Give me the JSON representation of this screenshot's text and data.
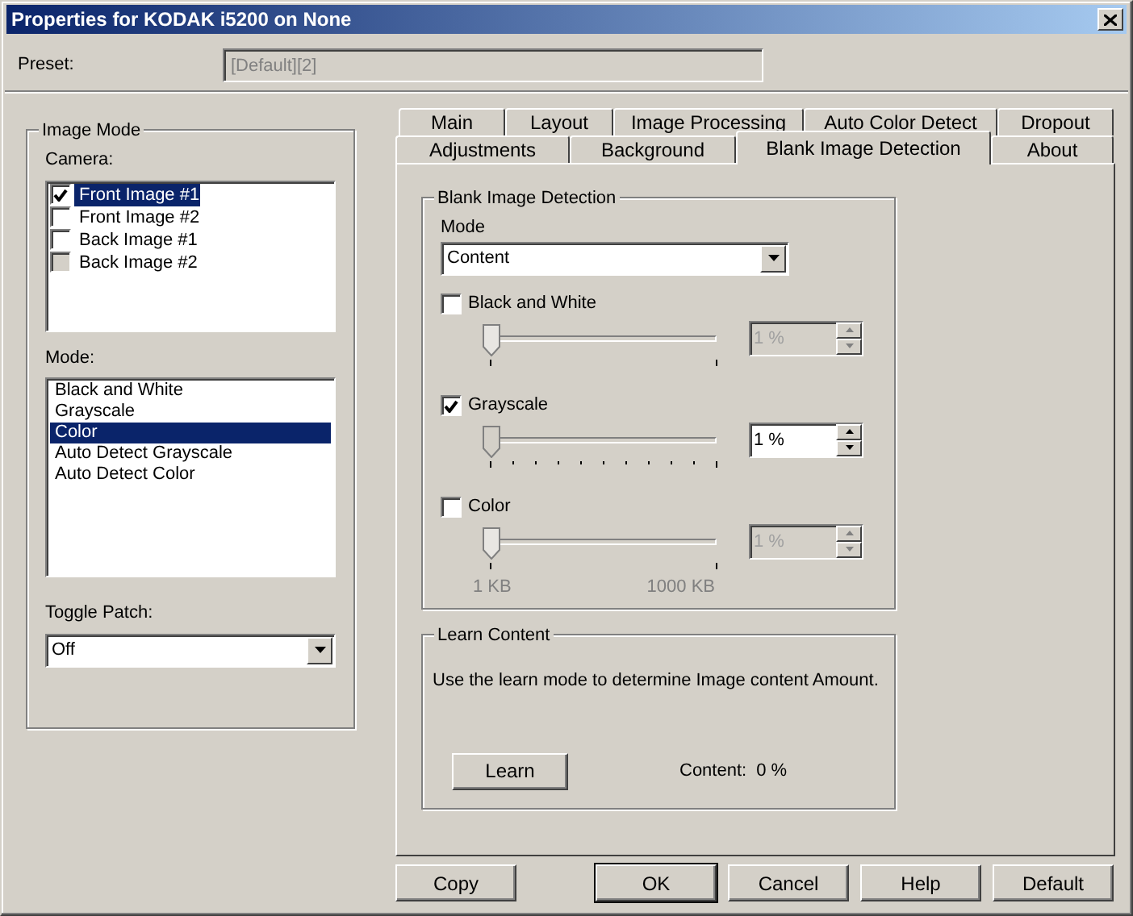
{
  "window": {
    "title": "Properties for KODAK i5200 on None"
  },
  "preset": {
    "label": "Preset:",
    "value": "[Default][2]",
    "disabled": true
  },
  "image_mode": {
    "title": "Image Mode",
    "camera_label": "Camera:",
    "cameras": [
      {
        "label": "Front Image #1",
        "checked": true,
        "disabled": false,
        "selected": true
      },
      {
        "label": "Front Image #2",
        "checked": false,
        "disabled": false,
        "selected": false
      },
      {
        "label": "Back Image #1",
        "checked": false,
        "disabled": false,
        "selected": false
      },
      {
        "label": "Back Image #2",
        "checked": false,
        "disabled": true,
        "selected": false
      }
    ],
    "mode_label": "Mode:",
    "modes": [
      {
        "label": "Black and White",
        "selected": false
      },
      {
        "label": "Grayscale",
        "selected": false
      },
      {
        "label": "Color",
        "selected": true
      },
      {
        "label": "Auto Detect Grayscale",
        "selected": false
      },
      {
        "label": "Auto Detect Color",
        "selected": false
      }
    ],
    "toggle_patch": {
      "label": "Toggle Patch:",
      "value": "Off"
    }
  },
  "tab_rows": [
    {
      "tabs": [
        {
          "label": "Main",
          "selected": false
        },
        {
          "label": "Layout",
          "selected": false
        },
        {
          "label": "Image Processing",
          "selected": false
        },
        {
          "label": "Auto Color Detect",
          "selected": false
        },
        {
          "label": "Dropout",
          "selected": false
        }
      ]
    },
    {
      "tabs": [
        {
          "label": "Adjustments",
          "selected": false
        },
        {
          "label": "Background",
          "selected": false
        },
        {
          "label": "Blank Image Detection",
          "selected": true
        },
        {
          "label": "About",
          "selected": false
        }
      ]
    }
  ],
  "blank_image_detection": {
    "title": "Blank Image Detection",
    "mode_label": "Mode",
    "mode_value": "Content",
    "options": [
      {
        "label": "Black and White",
        "checked": false,
        "level": 0,
        "value": "1 %"
      },
      {
        "label": "Grayscale",
        "checked": true,
        "level": 0,
        "value": "1 %"
      },
      {
        "label": "Color",
        "checked": false,
        "level": 0,
        "value": "1 %"
      }
    ],
    "scale_min": "1 KB",
    "scale_max": "1000 KB"
  },
  "learn_content": {
    "title": "Learn Content",
    "description": "Use the learn mode to determine Image content Amount.",
    "button": "Learn",
    "content_label": "Content:",
    "content_value": "0 %"
  },
  "copy_button": "Copy",
  "buttons": [
    {
      "label": "OK",
      "default": true
    },
    {
      "label": "Cancel",
      "default": false
    },
    {
      "label": "Help",
      "default": false
    },
    {
      "label": "Default",
      "default": false
    }
  ]
}
